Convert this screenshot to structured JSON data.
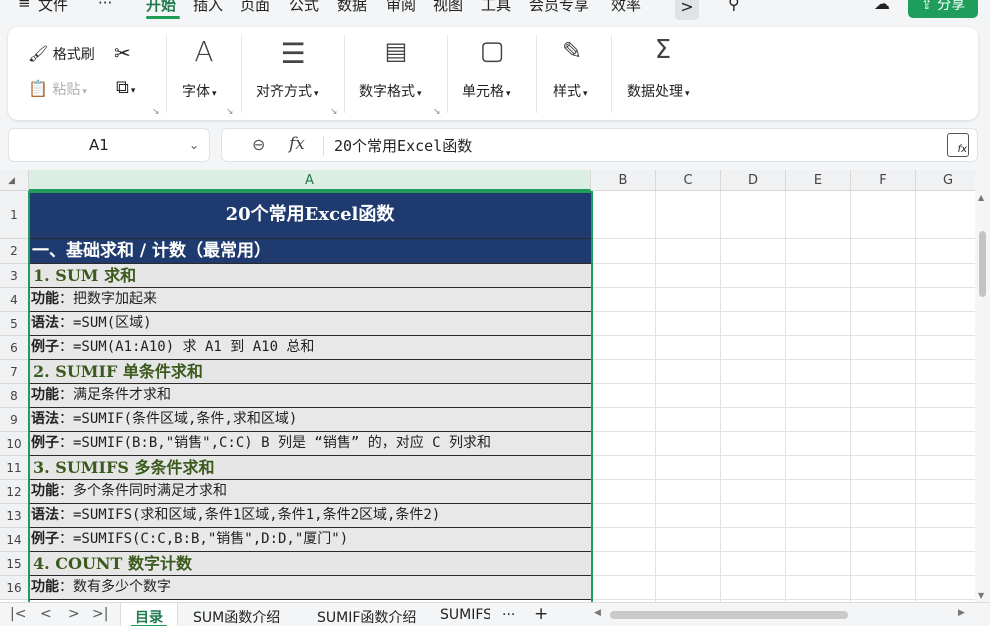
{
  "menubar": {
    "menu_icon": "≡",
    "file": "文件",
    "more": "···",
    "tabs": [
      "开始",
      "插入",
      "页面",
      "公式",
      "数据",
      "审阅",
      "视图",
      "工具",
      "会员专享",
      "效率"
    ],
    "next_arrow": ">",
    "share": "分享"
  },
  "ribbon": {
    "format_painter": "格式刷",
    "paste": "粘贴",
    "font": "字体",
    "alignment": "对齐方式",
    "number_format": "数字格式",
    "cells": "单元格",
    "styles": "样式",
    "data_processing": "数据处理"
  },
  "formula_bar": {
    "name_box": "A1",
    "fx": "fx",
    "content": "20个常用Excel函数"
  },
  "columns": [
    "A",
    "B",
    "C",
    "D",
    "E",
    "F",
    "G"
  ],
  "rows": [
    {
      "n": "1",
      "type": "title",
      "text": "20个常用Excel函数"
    },
    {
      "n": "2",
      "type": "section",
      "text": "一、基础求和 / 计数（最常用）"
    },
    {
      "n": "3",
      "type": "func",
      "text": "1. SUM 求和"
    },
    {
      "n": "4",
      "type": "desc",
      "label": "功能",
      "text": "：把数字加起来"
    },
    {
      "n": "5",
      "type": "desc",
      "label": "语法",
      "text": "：=SUM(区域)"
    },
    {
      "n": "6",
      "type": "desc",
      "label": "例子",
      "text": "：=SUM(A1:A10) 求 A1 到 A10 总和"
    },
    {
      "n": "7",
      "type": "func",
      "text": "2. SUMIF 单条件求和"
    },
    {
      "n": "8",
      "type": "desc",
      "label": "功能",
      "text": "：满足条件才求和"
    },
    {
      "n": "9",
      "type": "desc",
      "label": "语法",
      "text": "：=SUMIF(条件区域,条件,求和区域)"
    },
    {
      "n": "10",
      "type": "desc",
      "label": "例子",
      "text": "：=SUMIF(B:B,\"销售\",C:C) B 列是 “销售” 的，对应 C 列求和"
    },
    {
      "n": "11",
      "type": "func",
      "text": "3. SUMIFS 多条件求和"
    },
    {
      "n": "12",
      "type": "desc",
      "label": "功能",
      "text": "：多个条件同时满足才求和"
    },
    {
      "n": "13",
      "type": "desc",
      "label": "语法",
      "text": "：=SUMIFS(求和区域,条件1区域,条件1,条件2区域,条件2)"
    },
    {
      "n": "14",
      "type": "desc",
      "label": "例子",
      "text": "：=SUMIFS(C:C,B:B,\"销售\",D:D,\"厦门\")"
    },
    {
      "n": "15",
      "type": "func",
      "text": "4. COUNT 数字计数"
    },
    {
      "n": "16",
      "type": "desc",
      "label": "功能",
      "text": "：数有多少个数字"
    }
  ],
  "sheet_tabs": {
    "nav": [
      "|<",
      "<",
      ">",
      ">|"
    ],
    "tabs": [
      "目录",
      "SUM函数介绍",
      "SUMIF函数介绍",
      "SUMIFS"
    ],
    "more": "···",
    "add": "+"
  },
  "colors": {
    "accent": "#1e9e5a",
    "header_fill": "#1f3a6e",
    "row_fill": "#e6e6e6",
    "func_text": "#3a5a1e"
  }
}
